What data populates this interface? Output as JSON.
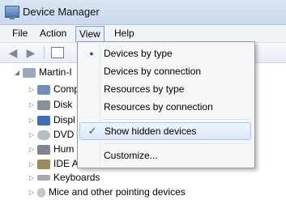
{
  "window": {
    "title": "Device Manager"
  },
  "menubar": {
    "file": "File",
    "action": "Action",
    "view": "View",
    "help": "Help"
  },
  "tree": {
    "root": "Martin-I",
    "items": [
      {
        "label": "Comp"
      },
      {
        "label": "Disk"
      },
      {
        "label": "Displ"
      },
      {
        "label": "DVD"
      },
      {
        "label": "Hum"
      },
      {
        "label": "IDE A"
      },
      {
        "label": "Keyboards"
      },
      {
        "label": "Mice and other pointing devices"
      }
    ]
  },
  "view_menu": {
    "devices_by_type": "Devices by type",
    "devices_by_connection": "Devices by connection",
    "resources_by_type": "Resources by type",
    "resources_by_connection": "Resources by connection",
    "show_hidden_devices": "Show hidden devices",
    "customize": "Customize...",
    "radio_mark": "●",
    "check_mark": "✓"
  }
}
